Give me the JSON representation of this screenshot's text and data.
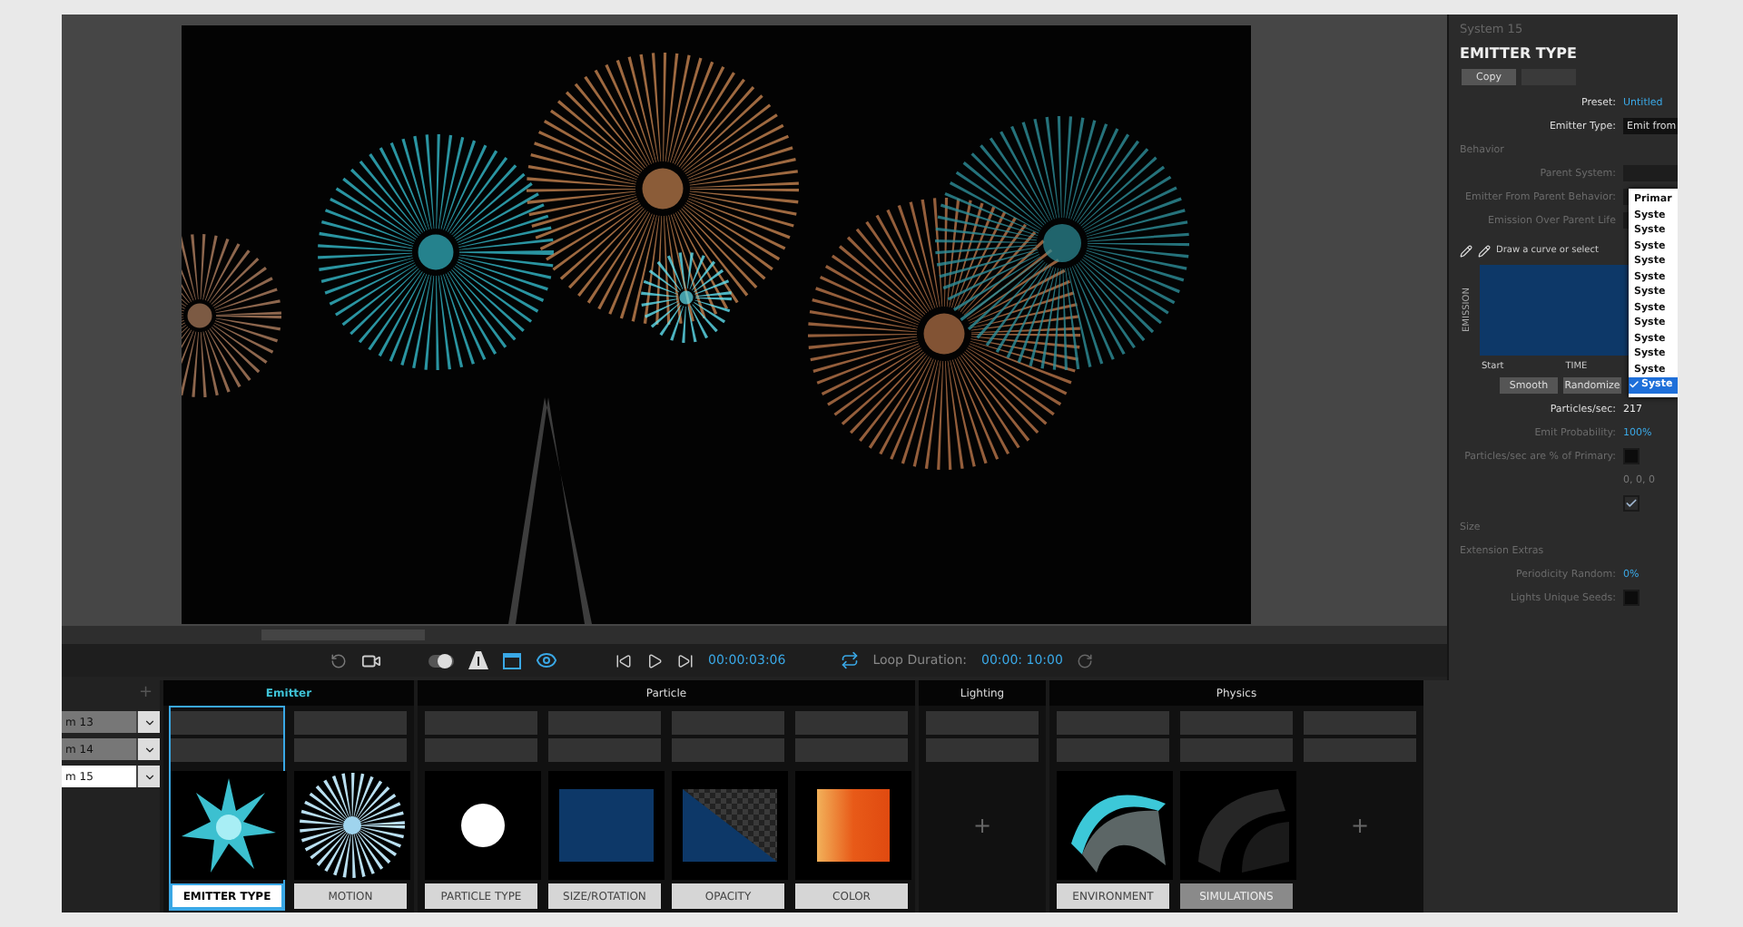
{
  "transport": {
    "time": "00:00:03:06",
    "loop_label": "Loop Duration:",
    "loop_duration": "00:00: 10:00"
  },
  "inspector": {
    "system": "System 15",
    "title": "EMITTER TYPE",
    "copy_button": "Copy",
    "rows": [
      {
        "kind": "value",
        "label": "Preset:",
        "value": "Untitled",
        "accent": true,
        "disabled": false
      },
      {
        "kind": "select",
        "label": "Emitter Type:",
        "value": "Emit from",
        "disabled": false
      },
      {
        "kind": "heading",
        "label": "Behavior",
        "disabled": true
      },
      {
        "kind": "select",
        "label": "Parent System:",
        "disabled": true
      },
      {
        "kind": "select",
        "label": "Emitter From Parent Behavior:",
        "disabled": true
      },
      {
        "kind": "select",
        "label": "Emission Over Parent Life",
        "disabled": true
      }
    ],
    "curve": {
      "hint": "Draw a curve or select",
      "axis": "EMISSION",
      "start": "Start",
      "time": "TIME",
      "buttons": [
        "Smooth",
        "Randomize"
      ]
    },
    "rows2": [
      {
        "kind": "value",
        "label": "Particles/sec:",
        "value": "217",
        "accent": false,
        "disabled": false
      },
      {
        "kind": "value",
        "label": "Emit Probability:",
        "value": "100%",
        "accent": true,
        "disabled": true
      },
      {
        "kind": "check",
        "label": "Particles/sec are % of Primary:",
        "checked": false,
        "disabled": true
      },
      {
        "kind": "value",
        "value": "0, 0, 0",
        "accent": false,
        "disabled": true
      },
      {
        "kind": "check",
        "checked": true,
        "disabled": true
      },
      {
        "kind": "heading",
        "label": "Size",
        "disabled": true
      },
      {
        "kind": "heading",
        "label": "Extension Extras",
        "disabled": true
      },
      {
        "kind": "value",
        "label": "Periodicity Random:",
        "value": "0%",
        "accent": true,
        "disabled": true
      },
      {
        "kind": "check",
        "label": "Lights Unique Seeds:",
        "checked": false,
        "disabled": true
      }
    ],
    "dropdown": [
      {
        "label": "Primar",
        "selected": false
      },
      {
        "label": "Syste",
        "selected": false
      },
      {
        "label": "Syste",
        "selected": false
      },
      {
        "label": "Syste",
        "selected": false
      },
      {
        "label": "Syste",
        "selected": false
      },
      {
        "label": "Syste",
        "selected": false
      },
      {
        "label": "Syste",
        "selected": false
      },
      {
        "label": "Syste",
        "selected": false
      },
      {
        "label": "Syste",
        "selected": false
      },
      {
        "label": "Syste",
        "selected": false
      },
      {
        "label": "Syste",
        "selected": false
      },
      {
        "label": "Syste",
        "selected": false
      },
      {
        "label": "Syste",
        "selected": true
      }
    ]
  },
  "modules": {
    "add_symbol": "+",
    "systems": [
      {
        "label": "m 13",
        "selected": false
      },
      {
        "label": "m 14",
        "selected": false
      },
      {
        "label": "m 15",
        "selected": true
      }
    ],
    "groups": [
      {
        "name": "Emitter",
        "selected": true,
        "cards": [
          {
            "kind": "emitter",
            "label": "EMITTER TYPE",
            "selected": true,
            "disabled": false
          },
          {
            "kind": "motion",
            "label": "MOTION",
            "selected": false,
            "disabled": false
          }
        ]
      },
      {
        "name": "Particle",
        "selected": false,
        "cards": [
          {
            "kind": "dot",
            "label": "PARTICLE TYPE",
            "selected": false,
            "disabled": false
          },
          {
            "kind": "square",
            "label": "SIZE/ROTATION",
            "selected": false,
            "disabled": false
          },
          {
            "kind": "opacity",
            "label": "OPACITY",
            "selected": false,
            "disabled": false
          },
          {
            "kind": "gradient",
            "label": "COLOR",
            "selected": false,
            "disabled": false
          }
        ]
      },
      {
        "name": "Lighting",
        "selected": false,
        "cards": [
          {
            "kind": "add",
            "label": "+"
          }
        ]
      },
      {
        "name": "Physics",
        "selected": false,
        "cards": [
          {
            "kind": "environment",
            "label": "ENVIRONMENT",
            "selected": false,
            "disabled": false
          },
          {
            "kind": "simulations",
            "label": "SIMULATIONS",
            "selected": false,
            "disabled": true
          },
          {
            "kind": "add",
            "label": "+"
          }
        ]
      }
    ]
  }
}
